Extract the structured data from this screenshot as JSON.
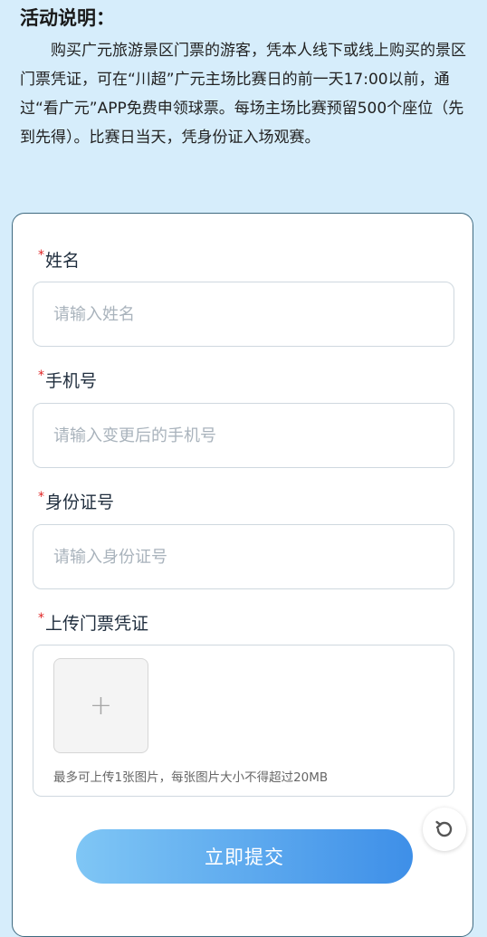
{
  "notice": {
    "title": "活动说明：",
    "body": "购买广元旅游景区门票的游客，凭本人线下或线上购买的景区门票凭证，可在“川超”广元主场比赛日的前一天17:00以前，通过“看广元”APP免费申领球票。每场主场比赛预留500个座位（先到先得）。比赛日当天，凭身份证入场观赛。"
  },
  "form": {
    "required_mark": "*",
    "name": {
      "label": "姓名",
      "placeholder": "请输入姓名",
      "value": ""
    },
    "phone": {
      "label": "手机号",
      "placeholder": "请输入变更后的手机号",
      "value": ""
    },
    "id_card": {
      "label": "身份证号",
      "placeholder": "请输入身份证号",
      "value": ""
    },
    "upload": {
      "label": "上传门票凭证",
      "plus": "+",
      "hint": "最多可上传1张图片，每张图片大小不得超过20MB"
    },
    "submit_label": "立即提交"
  },
  "icons": {
    "upload": "plus-icon",
    "refresh": "refresh-icon"
  },
  "colors": {
    "background": "#d6edfb",
    "required": "#e02424",
    "card_border": "#3f6a80",
    "button_gradient_start": "#7fc6f5",
    "button_gradient_end": "#3e8fe8"
  }
}
